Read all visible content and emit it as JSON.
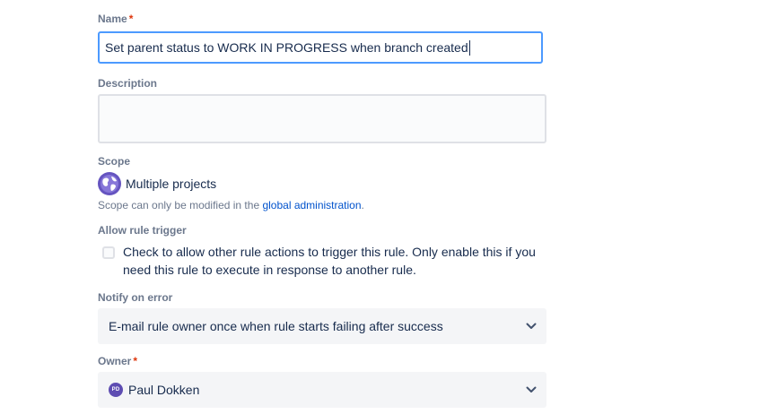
{
  "form": {
    "name": {
      "label": "Name",
      "required_mark": "*",
      "value": "Set parent status to WORK IN PROGRESS when branch created"
    },
    "description": {
      "label": "Description",
      "value": ""
    },
    "scope": {
      "label": "Scope",
      "value": "Multiple projects",
      "icon": "globe-icon",
      "note_prefix": "Scope can only be modified in the ",
      "note_link": "global administration",
      "note_suffix": "."
    },
    "allow_rule_trigger": {
      "label": "Allow rule trigger",
      "checked": false,
      "text": "Check to allow other rule actions to trigger this rule. Only enable this if you need this rule to execute in response to another rule."
    },
    "notify_on_error": {
      "label": "Notify on error",
      "selected": "E-mail rule owner once when rule starts failing after success"
    },
    "owner": {
      "label": "Owner",
      "required_mark": "*",
      "initials": "PD",
      "selected": "Paul Dokken"
    }
  },
  "colors": {
    "focus_border": "#4c9aff",
    "link": "#0052cc",
    "required": "#de350b",
    "scope_icon_bg": "#6554c0",
    "avatar_bg": "#5e4db2"
  }
}
